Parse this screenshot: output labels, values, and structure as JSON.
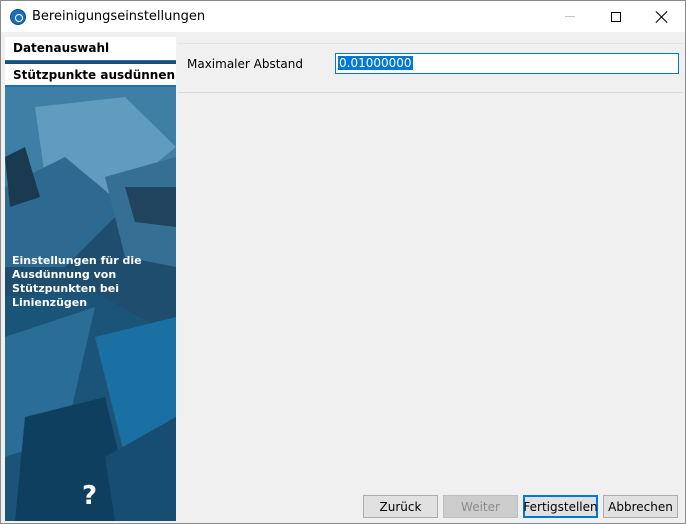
{
  "window": {
    "title": "Bereinigungseinstellungen"
  },
  "sidebar": {
    "steps": [
      {
        "label": "Datenauswahl"
      },
      {
        "label": "Stützpunkte ausdünnen"
      }
    ],
    "description": "Einstellungen für die Ausdünnung von Stützpunkten bei Linienzügen",
    "help_icon": "?"
  },
  "form": {
    "field_label": "Maximaler Abstand",
    "field_value": "0.01000000"
  },
  "buttons": {
    "back": "Zurück",
    "next": "Weiter",
    "finish": "Fertigstellen",
    "cancel": "Abbrechen"
  },
  "colors": {
    "accent": "#0078d7",
    "sidebar_bg": "#1f4e6e"
  }
}
